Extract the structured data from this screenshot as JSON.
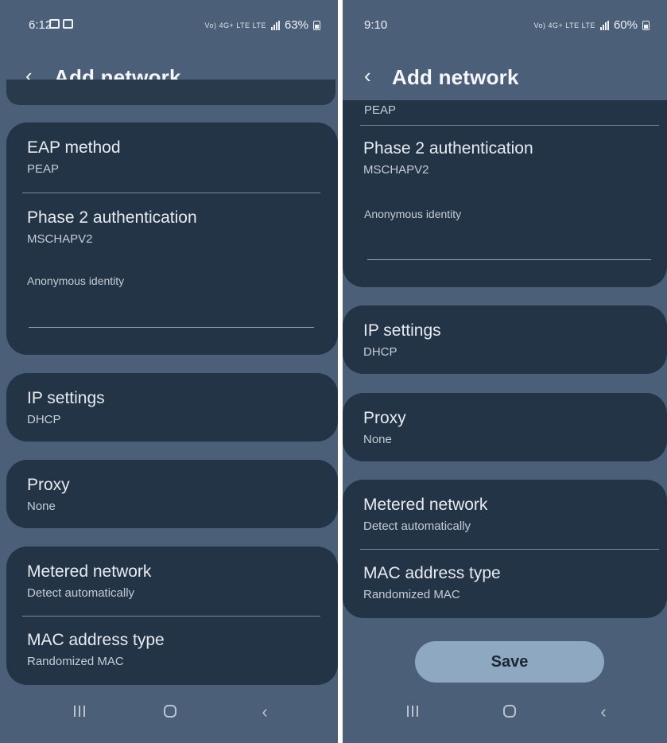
{
  "left": {
    "status_time": "6:12",
    "status_net": "Vo) 4G+ LTE LTE",
    "battery": "63%",
    "title": "Add network",
    "eap_method": {
      "title": "EAP method",
      "value": "PEAP"
    },
    "phase2": {
      "title": "Phase 2 authentication",
      "value": "MSCHAPV2"
    },
    "anonymous_identity": {
      "label": "Anonymous identity",
      "value": ""
    },
    "ip_settings": {
      "title": "IP settings",
      "value": "DHCP"
    },
    "proxy": {
      "title": "Proxy",
      "value": "None"
    },
    "metered": {
      "title": "Metered network",
      "value": "Detect automatically"
    },
    "mac": {
      "title": "MAC address type",
      "value": "Randomized MAC"
    }
  },
  "right": {
    "status_time": "9:10",
    "status_net": "Vo) 4G+ LTE LTE",
    "battery": "60%",
    "title": "Add network",
    "cut_value": "PEAP",
    "phase2": {
      "title": "Phase 2 authentication",
      "value": "MSCHAPV2"
    },
    "anonymous_identity": {
      "label": "Anonymous identity",
      "value": ""
    },
    "ip_settings": {
      "title": "IP settings",
      "value": "DHCP"
    },
    "proxy": {
      "title": "Proxy",
      "value": "None"
    },
    "metered": {
      "title": "Metered network",
      "value": "Detect automatically"
    },
    "mac": {
      "title": "MAC address type",
      "value": "Randomized MAC"
    },
    "save_label": "Save"
  },
  "colors": {
    "background": "#4b6078",
    "card": "#243447",
    "save_button": "#8fa8c2"
  },
  "icons": {
    "back": "chevron-left-icon",
    "nav_recents": "recents-icon",
    "nav_home": "home-icon",
    "nav_back": "nav-back-icon"
  }
}
